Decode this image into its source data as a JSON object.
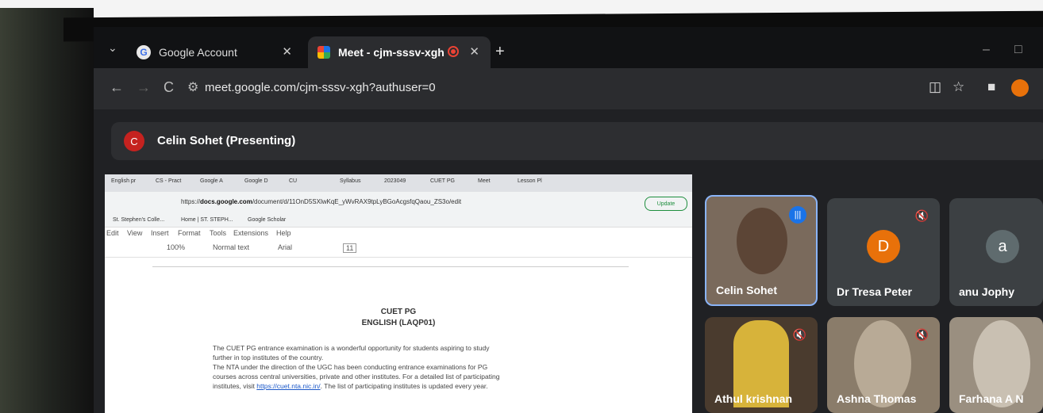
{
  "browser": {
    "tabs": [
      {
        "label": "Google Account",
        "active": false
      },
      {
        "label": "Meet - cjm-sssv-xgh",
        "active": true
      }
    ],
    "url": "meet.google.com/cjm-sssv-xgh?authuser=0",
    "new_tab_symbol": "+"
  },
  "meet": {
    "presenter_initial": "C",
    "presenter_label": "Celin Sohet (Presenting)",
    "participants": [
      {
        "name": "Celin Sohet",
        "avatar": "",
        "video": true,
        "speaking": true
      },
      {
        "name": "Dr Tresa Peter",
        "avatar": "D",
        "avatar_color": "#e8710a",
        "muted": true
      },
      {
        "name": "anu Jophy",
        "avatar": "a",
        "avatar_color": "#5f6b6e",
        "muted": true
      },
      {
        "name": "Athul krishnan",
        "avatar": "",
        "video": true,
        "muted": true
      },
      {
        "name": "Ashna Thomas",
        "avatar": "",
        "video": true,
        "muted": true
      },
      {
        "name": "Farhana A N",
        "avatar": "",
        "video": true,
        "muted": true
      }
    ]
  },
  "shared_screen": {
    "tabs": [
      "English pr",
      "CS - Pract",
      "Google A",
      "Google D",
      "CU",
      "Syllabus",
      "2023049",
      "CUET PG",
      "Meet",
      "Lesson Pl"
    ],
    "url_prefix": "https://",
    "url_domain": "docs.google.com",
    "url_rest": "/document/d/11OnD5SXlwKqE_yWvRAX9tpLyBGoAcgsfqQaou_ZS3o/edit",
    "update_label": "Update",
    "bookmarks": [
      "St. Stephen's Colle...",
      "Home | ST. STEPH...",
      "Google Scholar"
    ],
    "menu": [
      "Edit",
      "View",
      "Insert",
      "Format",
      "Tools",
      "Extensions",
      "Help"
    ],
    "toolbar": {
      "zoom": "100%",
      "style": "Normal text",
      "font": "Arial",
      "size": "11"
    },
    "doc": {
      "title1": "CUET PG",
      "title2": "ENGLISH (LAQP01)",
      "lines": [
        "The CUET PG entrance examination is a wonderful opportunity for students aspiring to study",
        "further in top institutes of the country.",
        "The NTA under the direction of the UGC has been conducting entrance examinations for PG",
        "courses across central universities, private and other institutes. For a detailed list of participating"
      ],
      "last_line_start": "institutes, visit ",
      "last_line_link": "https://cuet.nta.nic.in/",
      "last_line_end": ". The list of participating institutes is updated every year."
    }
  },
  "colors": {
    "meet_bg": "#202124",
    "tile_bg": "#3c4043",
    "speaking_border": "#8ab4f8"
  }
}
